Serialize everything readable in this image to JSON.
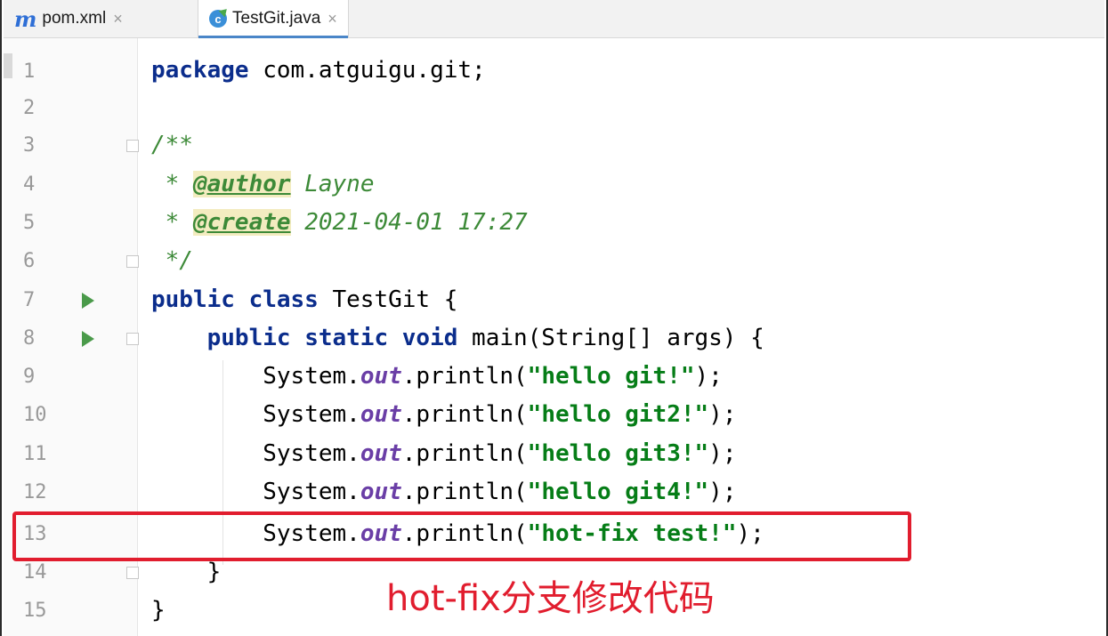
{
  "tabs": [
    {
      "icon": "maven-m-icon",
      "label": "pom.xml"
    },
    {
      "icon": "java-class-icon",
      "label": "TestGit.java",
      "active": true
    }
  ],
  "close_glyph": "×",
  "lines": [
    {
      "n": "1"
    },
    {
      "n": "2"
    },
    {
      "n": "3"
    },
    {
      "n": "4"
    },
    {
      "n": "5"
    },
    {
      "n": "6"
    },
    {
      "n": "7"
    },
    {
      "n": "8"
    },
    {
      "n": "9"
    },
    {
      "n": "10"
    },
    {
      "n": "11"
    },
    {
      "n": "12"
    },
    {
      "n": "13"
    },
    {
      "n": "14"
    },
    {
      "n": "15"
    }
  ],
  "code": {
    "l1_kw": "package",
    "l1_rest": " com.atguigu.git;",
    "l3": "/**",
    "l4_star": " * ",
    "l4_tag": "@author",
    "l4_val": " Layne",
    "l5_star": " * ",
    "l5_tag": "@create",
    "l5_val": " 2021-04-01 17:27",
    "l6": " */",
    "l7_kw": "public class",
    "l7_rest": " TestGit {",
    "l8_indent": "    ",
    "l8_kw": "public static void",
    "l8_rest": " main(String[] args) {",
    "print_indent": "        ",
    "print_prefix": "System.",
    "print_field": "out",
    "print_mid": ".println(",
    "print_suffix": ");",
    "s9": "\"hello git!\"",
    "s10": "\"hello git2!\"",
    "s11": "\"hello git3!\"",
    "s12": "\"hello git4!\"",
    "s13": "\"hot-fix test!\"",
    "l14": "    }",
    "l15": "}"
  },
  "annotation": {
    "text": "hot-fix分支修改代码",
    "color": "#e11d2e"
  }
}
